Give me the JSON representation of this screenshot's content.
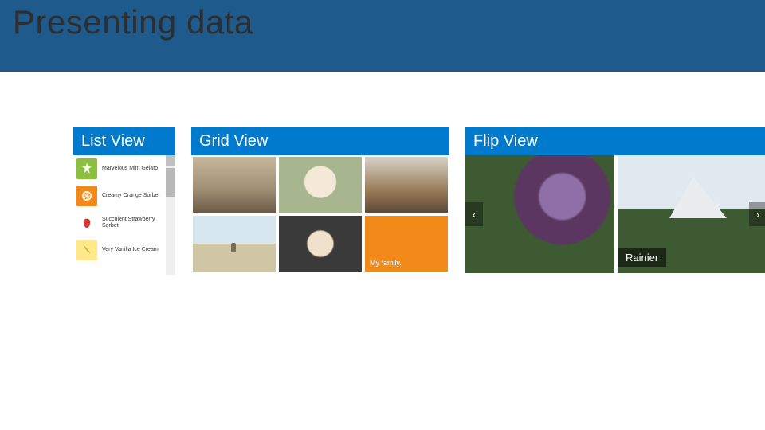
{
  "title": "Presenting data",
  "panels": {
    "list": {
      "header": "List View"
    },
    "grid": {
      "header": "Grid View",
      "caption": "My family."
    },
    "flip": {
      "header": "Flip View",
      "caption": "Rainier",
      "prev": "‹",
      "next": "›"
    }
  },
  "list_items": [
    {
      "label": "Marvelous Mint Gelato"
    },
    {
      "label": "Creamy Orange Sorbet"
    },
    {
      "label": "Succulent Strawberry Sorbet"
    },
    {
      "label": "Very Vanilla Ice Cream"
    }
  ]
}
